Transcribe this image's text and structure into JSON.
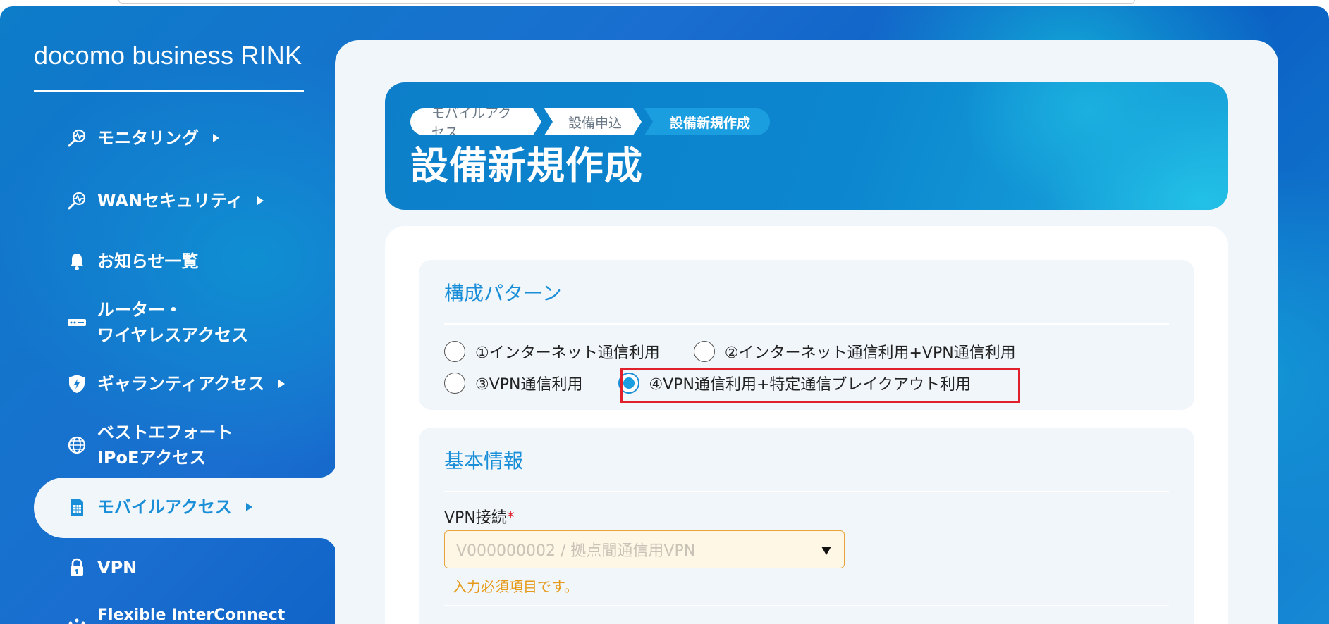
{
  "brand": "docomo business RINK",
  "sidebar": {
    "items": [
      {
        "label": "モニタリング",
        "icon": "monitoring-icon",
        "has_caret": true
      },
      {
        "label": "WANセキュリティ",
        "icon": "wan-security-icon",
        "has_caret": true
      },
      {
        "label": "お知らせ一覧",
        "icon": "bell-icon",
        "has_caret": false
      },
      {
        "label_line1": "ルーター・",
        "label_line2": "ワイヤレスアクセス",
        "icon": "router-icon",
        "has_caret": false
      },
      {
        "label": "ギャランティアクセス",
        "icon": "shield-bolt-icon",
        "has_caret": true
      },
      {
        "label_line1": "ベストエフォート",
        "label_line2": "IPoEアクセス",
        "icon": "globe-icon",
        "has_caret": false
      },
      {
        "label": "モバイルアクセス",
        "icon": "sim-card-icon",
        "has_caret": true,
        "active": true
      },
      {
        "label": "VPN",
        "icon": "lock-icon",
        "has_caret": false
      },
      {
        "label": "Flexible InterConnect",
        "icon": "dots-icon",
        "has_caret": false
      }
    ]
  },
  "hero": {
    "breadcrumbs": [
      "モバイルアクセス",
      "設備申込",
      "設備新規作成"
    ],
    "title": "設備新規作成"
  },
  "config_section": {
    "title": "構成パターン",
    "options": [
      {
        "label": "①インターネット通信利用",
        "selected": false
      },
      {
        "label": "②インターネット通信利用+VPN通信利用",
        "selected": false
      },
      {
        "label": "③VPN通信利用",
        "selected": false
      },
      {
        "label": "④VPN通信利用+特定通信ブレイクアウト利用",
        "selected": true
      }
    ]
  },
  "basic_section": {
    "title": "基本情報",
    "vpn_label": "VPN接続",
    "required_mark": "*",
    "vpn_placeholder": "V000000002 / 拠点間通信用VPN",
    "error_text": "入力必須項目です。"
  },
  "colors": {
    "accent": "#1a8fd8",
    "highlight": "#e0202a",
    "warning": "#e69a1a"
  }
}
